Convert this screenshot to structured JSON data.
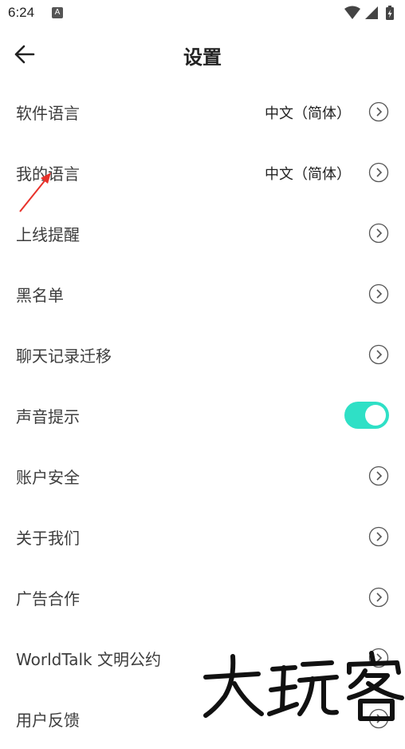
{
  "status_bar": {
    "time": "6:24",
    "notification_glyph": "A",
    "icons": [
      "wifi-icon",
      "signal-icon",
      "battery-charging-icon"
    ]
  },
  "header": {
    "title": "设置",
    "back_icon": "back-arrow-icon"
  },
  "settings": {
    "items": [
      {
        "label": "软件语言",
        "value": "中文（简体）",
        "control": "chevron"
      },
      {
        "label": "我的语言",
        "value": "中文（简体）",
        "control": "chevron"
      },
      {
        "label": "上线提醒",
        "control": "chevron"
      },
      {
        "label": "黑名单",
        "control": "chevron"
      },
      {
        "label": "聊天记录迁移",
        "control": "chevron"
      },
      {
        "label": "声音提示",
        "control": "toggle",
        "toggle_on": true
      },
      {
        "label": "账户安全",
        "control": "chevron"
      },
      {
        "label": "关于我们",
        "control": "chevron"
      },
      {
        "label": "广告合作",
        "control": "chevron"
      },
      {
        "label": "WorldTalk 文明公约",
        "control": "chevron"
      },
      {
        "label": "用户反馈",
        "control": "chevron"
      }
    ]
  },
  "annotation": {
    "arrow_color": "#e8322b"
  },
  "watermark": {
    "text": "大玩客"
  },
  "colors": {
    "toggle_accent": "#2fe0c6",
    "text": "#3c3c3c"
  }
}
